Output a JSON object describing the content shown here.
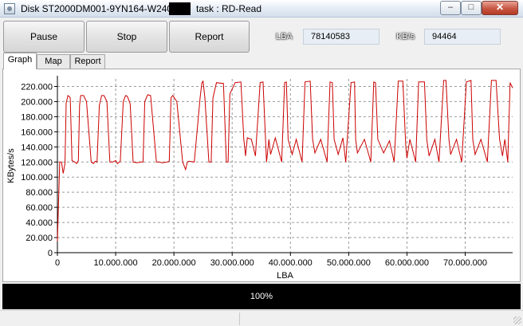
{
  "window": {
    "title_prefix": "Disk ST2000DM001-9YN164-W240",
    "title_task": "task : RD-Read",
    "min_glyph": "–",
    "max_glyph": "□",
    "close_glyph": "✕"
  },
  "toolbar": {
    "pause_label": "Pause",
    "stop_label": "Stop",
    "report_label": "Report",
    "lba_label": "LBA",
    "lba_value": "78140583",
    "kbs_label": "KB/s",
    "kbs_value": "94464"
  },
  "tabs": [
    {
      "label": "Graph",
      "active": true
    },
    {
      "label": "Map",
      "active": false
    },
    {
      "label": "Report",
      "active": false
    }
  ],
  "progress": {
    "text": "100%",
    "value": 1.0
  },
  "chart_data": {
    "type": "line",
    "xlabel": "LBA",
    "ylabel": "KBytes/s",
    "xlim": [
      0,
      78140583
    ],
    "ylim": [
      0,
      230000
    ],
    "grid": true,
    "x_ticks": [
      0,
      10000000,
      20000000,
      30000000,
      40000000,
      50000000,
      60000000,
      70000000
    ],
    "x_tick_labels": [
      "0",
      "10.000.000",
      "20.000.000",
      "30.000.000",
      "40.000.000",
      "50.000.000",
      "60.000.000",
      "70.000.000"
    ],
    "y_ticks": [
      0,
      20000,
      40000,
      60000,
      80000,
      100000,
      120000,
      140000,
      160000,
      180000,
      200000,
      220000
    ],
    "y_tick_labels": [
      "0",
      "20.000",
      "40.000",
      "60.000",
      "80.000",
      "100.000",
      "120.000",
      "140.000",
      "160.000",
      "180.000",
      "200.000",
      "220.000"
    ],
    "series": [
      {
        "color": "#cc0000",
        "x": [
          0,
          200000,
          400000,
          700000,
          1000000,
          1300000,
          1500000,
          1800000,
          2000000,
          2200000,
          2500000,
          3000000,
          3300000,
          3600000,
          3800000,
          4000000,
          4500000,
          5000000,
          5800000,
          6200000,
          6500000,
          6800000,
          7200000,
          7600000,
          8000000,
          8500000,
          9000000,
          9500000,
          10000000,
          10300000,
          10800000,
          11300000,
          11700000,
          12000000,
          12500000,
          13000000,
          13700000,
          14200000,
          14700000,
          15000000,
          15500000,
          16000000,
          17000000,
          17500000,
          18000000,
          18800000,
          19200000,
          19500000,
          19800000,
          20500000,
          21500000,
          22000000,
          22300000,
          22600000,
          23500000,
          24500000,
          24800000,
          25000000,
          25300000,
          26000000,
          26400000,
          26700000,
          27300000,
          28500000,
          29000000,
          29300000,
          29600000,
          30500000,
          31500000,
          32000000,
          32300000,
          32600000,
          33300000,
          34000000,
          34800000,
          35300000,
          35900000,
          36300000,
          36600000,
          37400000,
          38500000,
          39000000,
          39300000,
          39600000,
          40300000,
          41000000,
          42000000,
          42500000,
          43400000,
          43800000,
          44200000,
          45200000,
          46300000,
          46800000,
          47200000,
          47500000,
          48200000,
          49000000,
          49500000,
          50400000,
          51000000,
          51200000,
          51500000,
          52700000,
          53800000,
          54300000,
          54600000,
          55000000,
          56000000,
          57000000,
          57800000,
          58500000,
          59300000,
          59800000,
          60000000,
          60500000,
          61500000,
          62000000,
          63000000,
          63400000,
          63800000,
          64800000,
          65500000,
          66300000,
          66700000,
          67200000,
          67500000,
          68500000,
          69400000,
          70200000,
          71000000,
          71300000,
          71700000,
          72700000,
          73800000,
          74500000,
          75300000,
          75900000,
          76400000,
          76800000,
          77300000,
          77700000,
          78140583
        ],
        "y": [
          15000,
          70000,
          120000,
          120000,
          105000,
          118000,
          198000,
          208000,
          207000,
          205000,
          122000,
          120000,
          118000,
          122000,
          195000,
          208000,
          208000,
          200000,
          120000,
          118000,
          121000,
          120000,
          195000,
          208000,
          208000,
          200000,
          120000,
          120000,
          122000,
          118000,
          121000,
          200000,
          208000,
          207000,
          197000,
          120000,
          119000,
          120000,
          120000,
          200000,
          209000,
          208000,
          120000,
          120000,
          119000,
          120000,
          121000,
          205000,
          208000,
          200000,
          120000,
          110000,
          120000,
          121000,
          120000,
          205000,
          225000,
          227000,
          206000,
          120000,
          120000,
          205000,
          225000,
          224000,
          120000,
          120000,
          210000,
          225000,
          226000,
          150000,
          128000,
          152000,
          150000,
          128000,
          225000,
          226000,
          120000,
          150000,
          130000,
          152000,
          120000,
          225000,
          226000,
          150000,
          130000,
          150000,
          120000,
          226000,
          227000,
          150000,
          132000,
          150000,
          120000,
          226000,
          225000,
          150000,
          130000,
          152000,
          120000,
          225000,
          226000,
          150000,
          132000,
          150000,
          120000,
          226000,
          225000,
          150000,
          132000,
          148000,
          120000,
          227000,
          227000,
          140000,
          125000,
          150000,
          120000,
          226000,
          226000,
          150000,
          128000,
          150000,
          120000,
          228000,
          228000,
          150000,
          130000,
          150000,
          120000,
          226000,
          228000,
          150000,
          130000,
          150000,
          120000,
          228000,
          228000,
          150000,
          128000,
          150000,
          120000,
          225000,
          218000
        ]
      }
    ]
  }
}
